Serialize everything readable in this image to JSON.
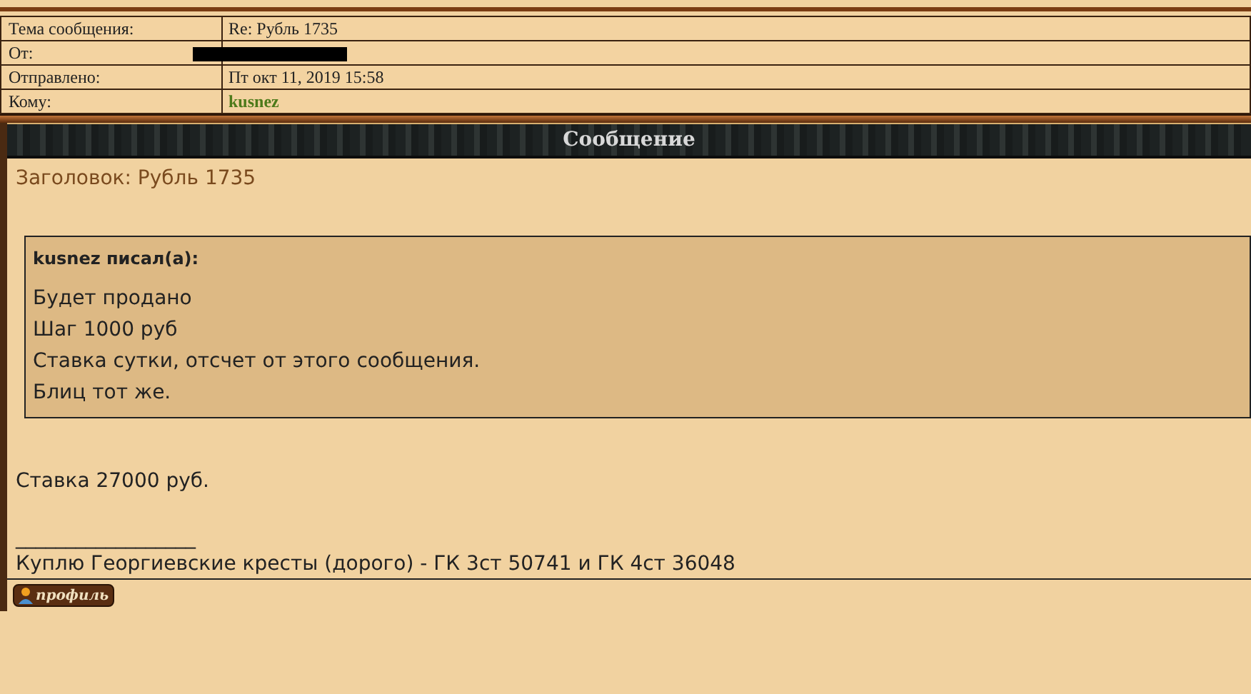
{
  "header_fields": [
    {
      "label": "Тема сообщения:",
      "value": "Re: Рубль 1735",
      "kind": "text"
    },
    {
      "label": "От:",
      "kind": "redacted"
    },
    {
      "label": "Отправлено:",
      "value": "Пт окт 11, 2019 15:58",
      "kind": "text"
    },
    {
      "label": "Кому:",
      "value": "kusnez",
      "kind": "user"
    }
  ],
  "section_title": "Сообщение",
  "subject": "Заголовок: Рубль 1735",
  "quote": {
    "author": "kusnez писал(а):",
    "lines": [
      "Будет продано",
      "Шаг 1000 руб",
      "Ставка сутки, отсчет от этого сообщения.",
      "Блиц тот же."
    ]
  },
  "reply": "Ставка 27000 руб.",
  "signature": {
    "separator": "__________________",
    "text": "Куплю Георгиевские кресты (дорого) - ГК 3ст 50741 и ГК 4ст 36048"
  },
  "buttons": [
    {
      "label": "профиль"
    }
  ]
}
